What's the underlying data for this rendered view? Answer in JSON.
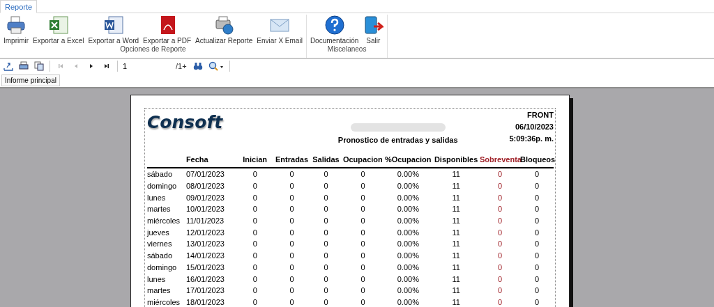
{
  "ribbon": {
    "tabs": [
      {
        "label": "Reporte",
        "selected": true
      }
    ],
    "groups": [
      {
        "label": "Opciones de Reporte",
        "buttons": [
          {
            "label": "Imprimir",
            "kind": "printer"
          },
          {
            "label": "Exportar a Excel",
            "kind": "excel"
          },
          {
            "label": "Exportar a Word",
            "kind": "word"
          },
          {
            "label": "Exportar a PDF",
            "kind": "pdf"
          },
          {
            "label": "Actualizar Reporte",
            "kind": "refresh"
          },
          {
            "label": "Enviar X Email",
            "kind": "email"
          }
        ]
      },
      {
        "label": "Miscelaneos",
        "buttons": [
          {
            "label": "Documentación",
            "kind": "help"
          },
          {
            "label": "Salir",
            "kind": "exit"
          }
        ]
      }
    ]
  },
  "toolbar": {
    "tools": [
      {
        "kind": "export",
        "disabled": false
      },
      {
        "kind": "print",
        "disabled": false
      },
      {
        "kind": "copy",
        "disabled": false
      }
    ],
    "nav": [
      {
        "kind": "first",
        "disabled": true
      },
      {
        "kind": "prev",
        "disabled": true
      },
      {
        "kind": "next",
        "disabled": false
      },
      {
        "kind": "last",
        "disabled": false
      }
    ],
    "page_field": {
      "value": "1"
    },
    "page_count": "/1+"
  },
  "document_tabs": [
    {
      "label": "Informe principal",
      "selected": true
    }
  ],
  "report": {
    "logo": "Consoft",
    "title": "Pronostico de entradas y salidas",
    "info": [
      "FRONT",
      "06/10/2023",
      "5:09:36p. m."
    ],
    "columns": [
      {
        "label": "Fecha"
      },
      {
        "label": "Inician"
      },
      {
        "label": "Entradas"
      },
      {
        "label": "Salidas"
      },
      {
        "label": "Ocupacion"
      },
      {
        "label": "%Ocupacion"
      },
      {
        "label": "Disponibles"
      },
      {
        "label": "Sobreventa",
        "color": "#a0232a"
      },
      {
        "label": "Bloqueos"
      }
    ],
    "rows": [
      {
        "weekday": "sábado",
        "cells": [
          "07/01/2023",
          "0",
          "0",
          "0",
          "0",
          "0.00%",
          "11",
          "0",
          "0"
        ]
      },
      {
        "weekday": "domingo",
        "cells": [
          "08/01/2023",
          "0",
          "0",
          "0",
          "0",
          "0.00%",
          "11",
          "0",
          "0"
        ]
      },
      {
        "weekday": "lunes",
        "cells": [
          "09/01/2023",
          "0",
          "0",
          "0",
          "0",
          "0.00%",
          "11",
          "0",
          "0"
        ]
      },
      {
        "weekday": "martes",
        "cells": [
          "10/01/2023",
          "0",
          "0",
          "0",
          "0",
          "0.00%",
          "11",
          "0",
          "0"
        ]
      },
      {
        "weekday": "miércoles",
        "cells": [
          "11/01/2023",
          "0",
          "0",
          "0",
          "0",
          "0.00%",
          "11",
          "0",
          "0"
        ]
      },
      {
        "weekday": "jueves",
        "cells": [
          "12/01/2023",
          "0",
          "0",
          "0",
          "0",
          "0.00%",
          "11",
          "0",
          "0"
        ]
      },
      {
        "weekday": "viernes",
        "cells": [
          "13/01/2023",
          "0",
          "0",
          "0",
          "0",
          "0.00%",
          "11",
          "0",
          "0"
        ]
      },
      {
        "weekday": "sábado",
        "cells": [
          "14/01/2023",
          "0",
          "0",
          "0",
          "0",
          "0.00%",
          "11",
          "0",
          "0"
        ]
      },
      {
        "weekday": "domingo",
        "cells": [
          "15/01/2023",
          "0",
          "0",
          "0",
          "0",
          "0.00%",
          "11",
          "0",
          "0"
        ]
      },
      {
        "weekday": "lunes",
        "cells": [
          "16/01/2023",
          "0",
          "0",
          "0",
          "0",
          "0.00%",
          "11",
          "0",
          "0"
        ]
      },
      {
        "weekday": "martes",
        "cells": [
          "17/01/2023",
          "0",
          "0",
          "0",
          "0",
          "0.00%",
          "11",
          "0",
          "0"
        ]
      },
      {
        "weekday": "miércoles",
        "cells": [
          "18/01/2023",
          "0",
          "0",
          "0",
          "0",
          "0.00%",
          "11",
          "0",
          "0"
        ]
      }
    ]
  }
}
